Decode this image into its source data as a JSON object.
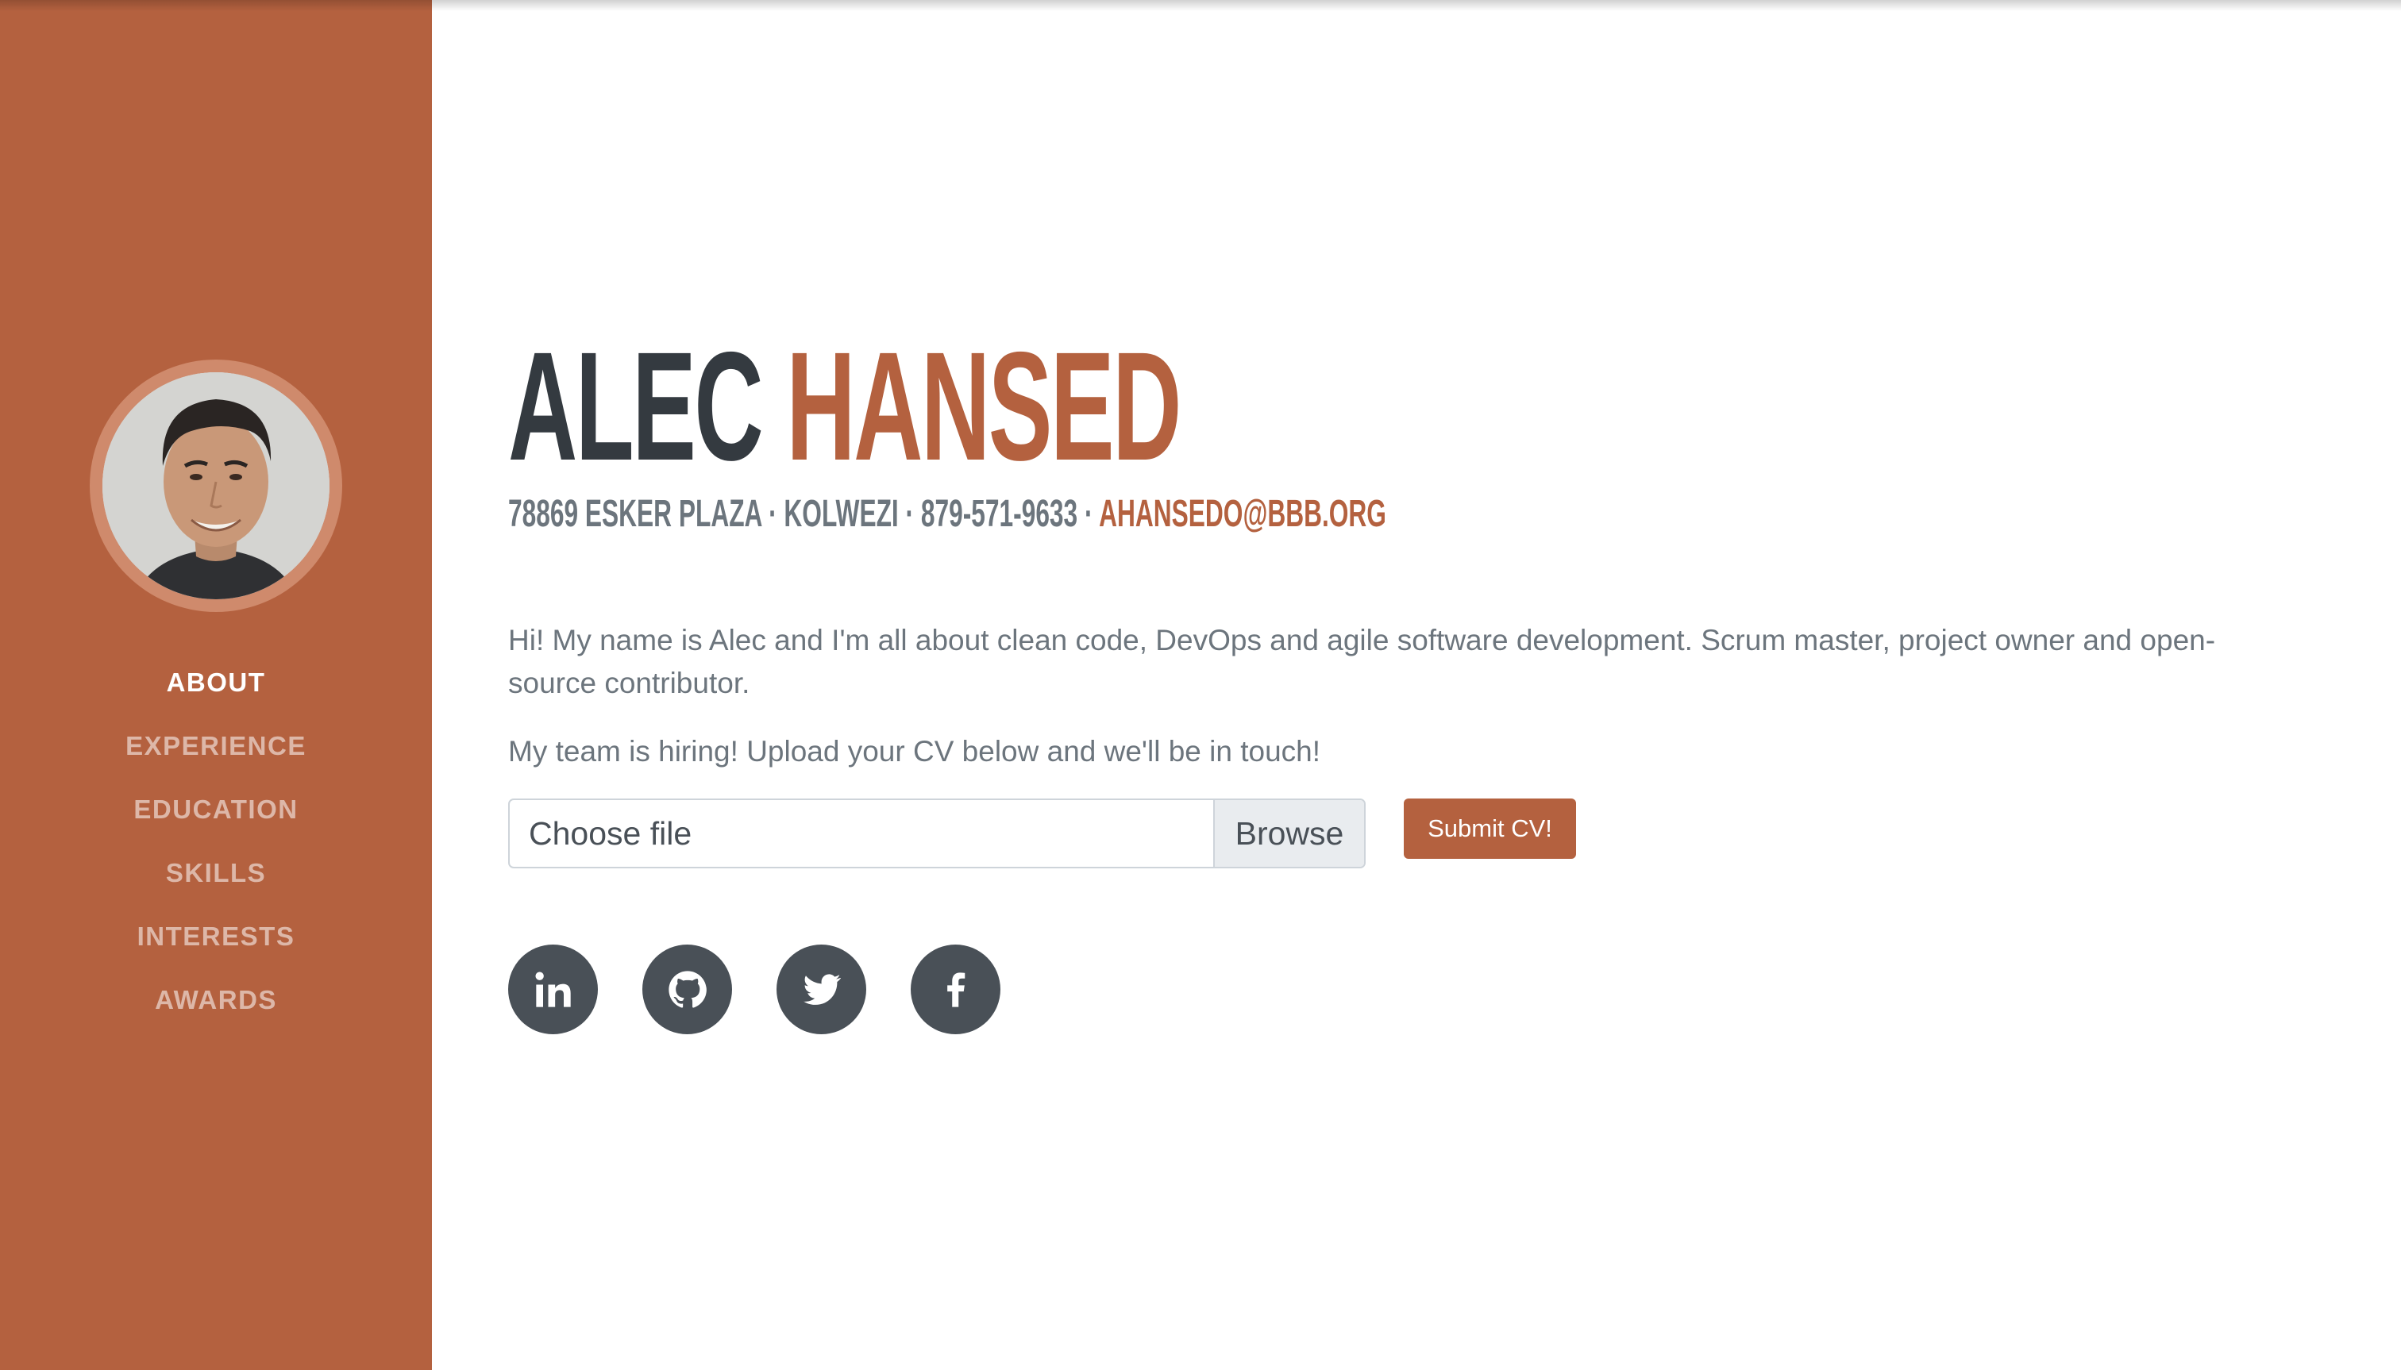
{
  "sidebar": {
    "nav": [
      {
        "label": "ABOUT",
        "active": true
      },
      {
        "label": "EXPERIENCE",
        "active": false
      },
      {
        "label": "EDUCATION",
        "active": false
      },
      {
        "label": "SKILLS",
        "active": false
      },
      {
        "label": "INTERESTS",
        "active": false
      },
      {
        "label": "AWARDS",
        "active": false
      }
    ]
  },
  "header": {
    "first_name": "ALEC",
    "last_name": "HANSED",
    "address": "78869 ESKER PLAZA",
    "city": "KOLWEZI",
    "phone": "879-571-9633",
    "email": "AHANSEDO@BBB.ORG",
    "separator": " · "
  },
  "about": {
    "intro": "Hi! My name is Alec and I'm all about clean code, DevOps and agile software development. Scrum master, project owner and open-source contributor.",
    "hiring": "My team is hiring! Upload your CV below and we'll be in touch!"
  },
  "upload": {
    "file_placeholder": "Choose file",
    "browse_label": "Browse",
    "submit_label": "Submit CV!"
  },
  "social": [
    {
      "icon": "linkedin-icon"
    },
    {
      "icon": "github-icon"
    },
    {
      "icon": "twitter-icon"
    },
    {
      "icon": "facebook-icon"
    }
  ],
  "colors": {
    "primary": "#b4613f",
    "dark": "#343a40",
    "muted": "#6c757d",
    "social_bg": "#495057"
  }
}
